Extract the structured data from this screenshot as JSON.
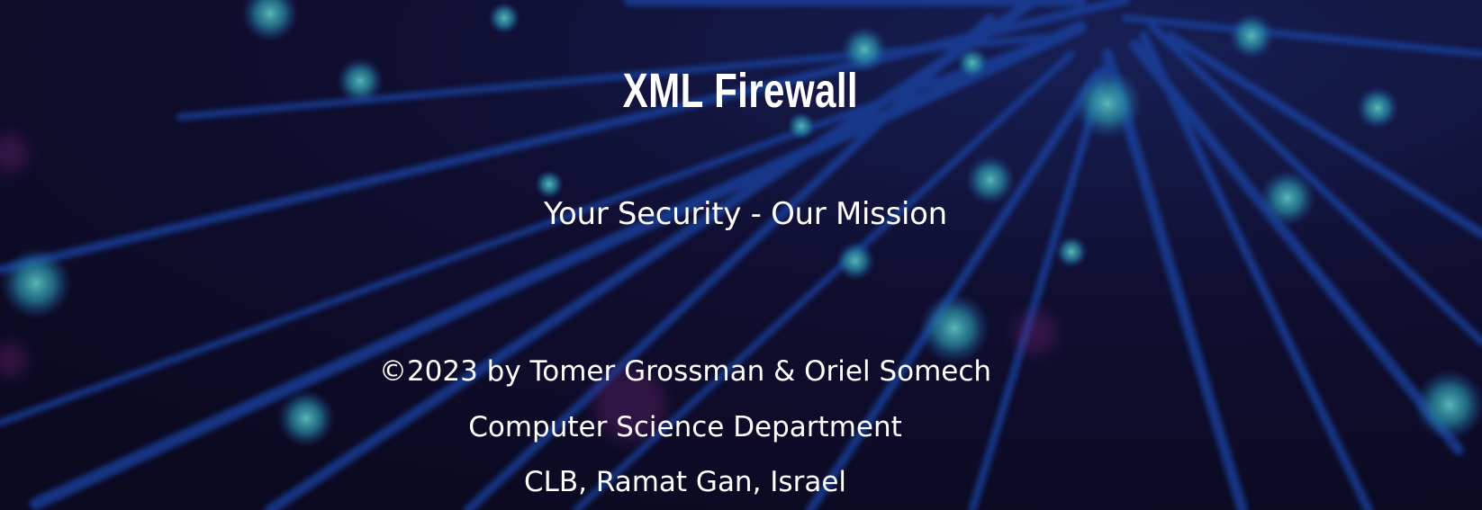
{
  "hero": {
    "title": "XML Firewall",
    "subtitle": "Your Security - Our Mission"
  },
  "footer": {
    "copyright": "©2023 by Tomer Grossman & Oriel Somech",
    "department": "Computer Science Department",
    "location": "CLB, Ramat Gan, Israel"
  },
  "colors": {
    "background": "#0e0c26",
    "fiber": "#1f4fb8",
    "glow": "#49d0d6",
    "text": "#ffffff"
  }
}
